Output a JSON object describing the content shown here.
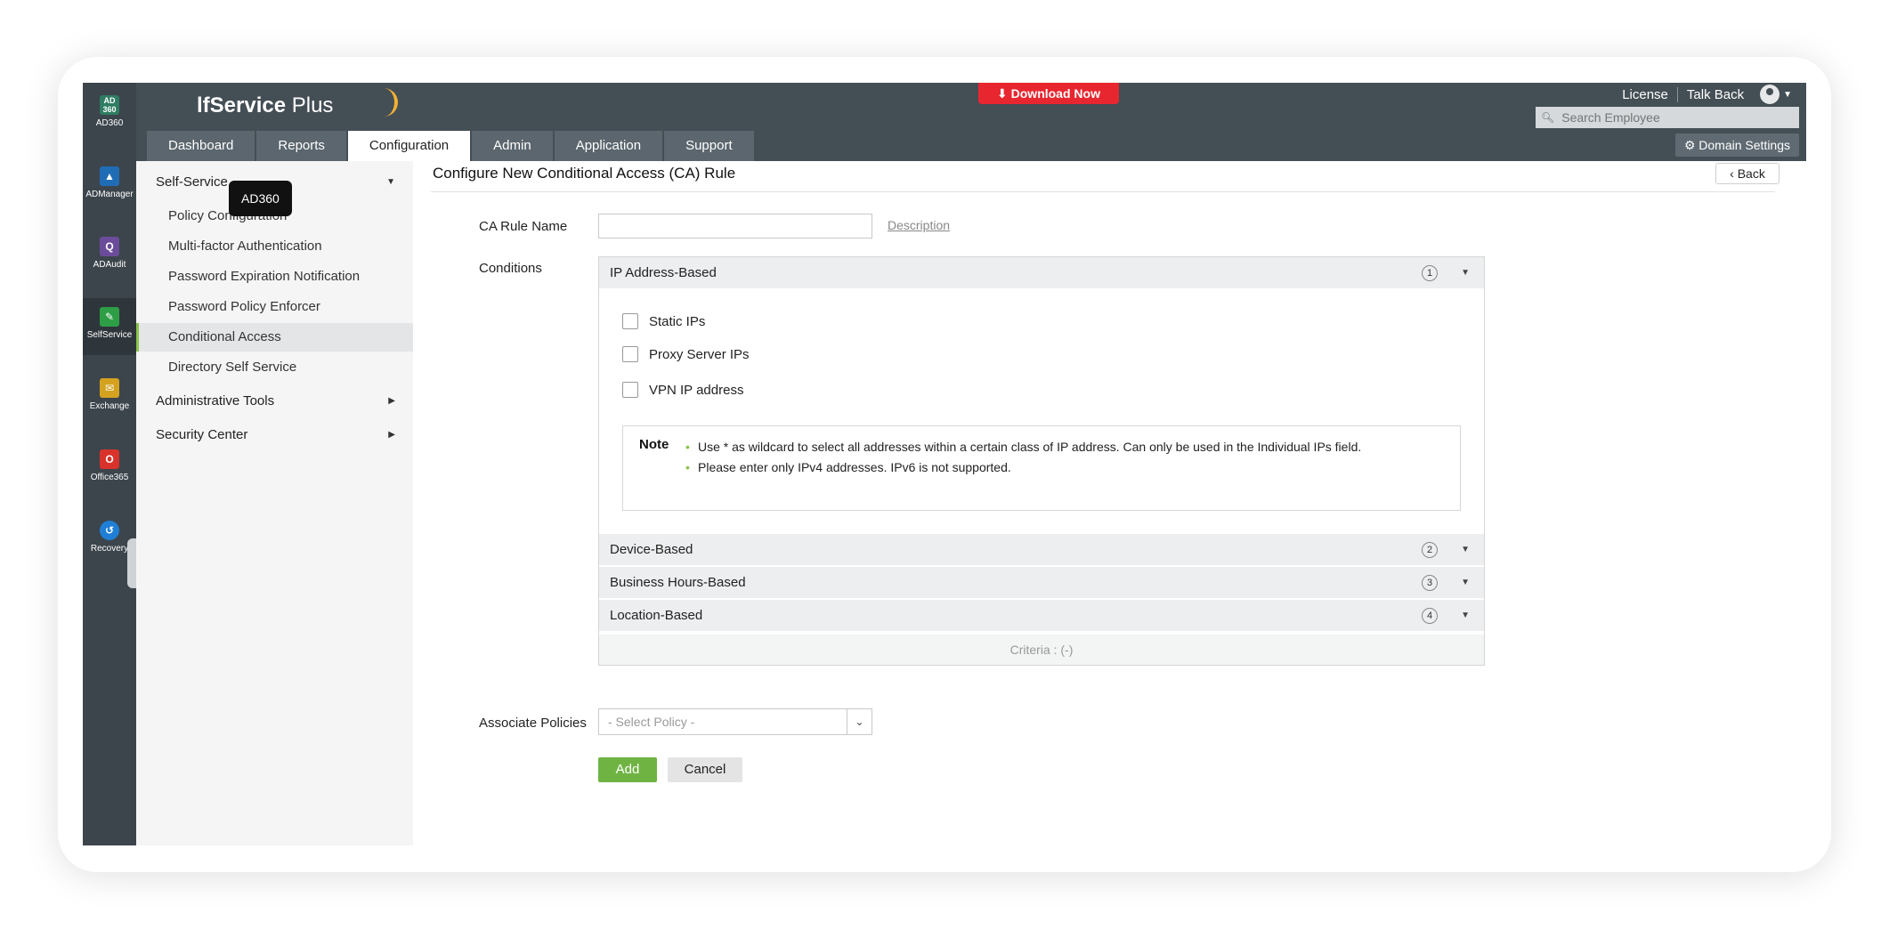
{
  "colors": {
    "rail_bg": "#3c454c",
    "header_bg": "#444e55",
    "accent_green": "#6fb443",
    "download_red": "#e8262f"
  },
  "rail": {
    "items": [
      {
        "icon": "ad360-icon",
        "glyph": "AD\n360",
        "label": "AD360",
        "color": "#2e7d62"
      },
      {
        "icon": "admanager-icon",
        "glyph": "▲",
        "label": "ADManager",
        "color": "#1f6db5"
      },
      {
        "icon": "adaudit-icon",
        "glyph": "Q",
        "label": "ADAudit",
        "color": "#6b4c9a"
      },
      {
        "icon": "selfservice-icon",
        "glyph": "✎",
        "label": "SelfService",
        "color": "#2e9e46"
      },
      {
        "icon": "exchange-icon",
        "glyph": "✉",
        "label": "Exchange",
        "color": "#d4a21f"
      },
      {
        "icon": "office365-icon",
        "glyph": "O",
        "label": "Office365",
        "color": "#d8322a"
      },
      {
        "icon": "recovery-icon",
        "glyph": "↺",
        "label": "Recovery",
        "color": "#1f7fd6"
      }
    ]
  },
  "tooltip": "AD360",
  "header": {
    "logo_bold": "lfService",
    "logo_thin": " Plus",
    "download": "Download Now",
    "links": [
      "License",
      "Talk Back"
    ],
    "search_placeholder": "Search Employee",
    "domain_settings": "Domain Settings",
    "tabs": [
      "Dashboard",
      "Reports",
      "Configuration",
      "Admin",
      "Application",
      "Support"
    ]
  },
  "sidebar": {
    "group1": "Self-Service",
    "items": [
      "Policy Configuration",
      "Multi-factor Authentication",
      "Password Expiration Notification",
      "Password Policy Enforcer",
      "Conditional Access",
      "Directory Self Service"
    ],
    "group2": "Administrative Tools",
    "group3": "Security Center"
  },
  "main": {
    "title": "Configure New Conditional Access (CA) Rule",
    "back": "Back",
    "rule_name_label": "CA Rule Name",
    "description_link": "Description",
    "conditions_label": "Conditions",
    "conditions": [
      {
        "title": "IP Address-Based",
        "num": "1"
      },
      {
        "title": "Device-Based",
        "num": "2"
      },
      {
        "title": "Business Hours-Based",
        "num": "3"
      },
      {
        "title": "Location-Based",
        "num": "4"
      }
    ],
    "checkboxes": [
      "Static IPs",
      "Proxy Server IPs",
      "VPN IP address"
    ],
    "note_label": "Note",
    "notes": [
      "Use * as wildcard to select all addresses within a certain class of IP address. Can only be used in the Individual IPs field.",
      "Please enter only IPv4 addresses. IPv6 is not supported."
    ],
    "criteria": "Criteria : (-)",
    "associate_label": "Associate Policies",
    "select_placeholder": "- Select Policy -",
    "add": "Add",
    "cancel": "Cancel"
  }
}
